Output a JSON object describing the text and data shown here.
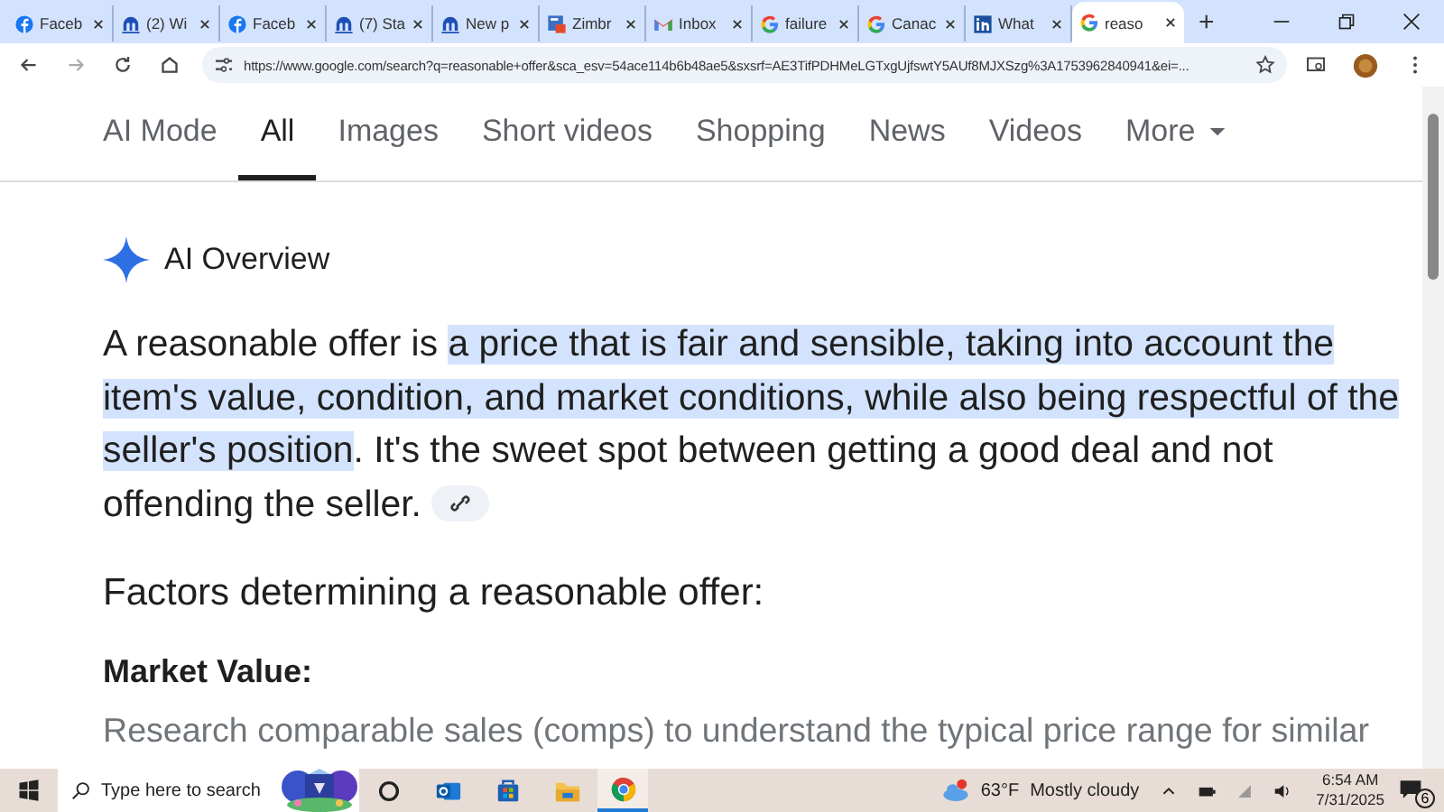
{
  "browser": {
    "tabs": [
      {
        "title": "Faceb",
        "kind": "facebook",
        "selected": false
      },
      {
        "title": "(2) Wi",
        "kind": "m",
        "selected": false
      },
      {
        "title": "Faceb",
        "kind": "facebook",
        "selected": false
      },
      {
        "title": "(7) Sta",
        "kind": "m",
        "selected": false
      },
      {
        "title": "New p",
        "kind": "m",
        "selected": false
      },
      {
        "title": "Zimbr",
        "kind": "zimbra",
        "selected": false
      },
      {
        "title": "Inbox",
        "kind": "gmail",
        "selected": false
      },
      {
        "title": "failure",
        "kind": "google",
        "selected": false
      },
      {
        "title": "Canac",
        "kind": "google",
        "selected": false
      },
      {
        "title": "What",
        "kind": "linkedin",
        "selected": false
      },
      {
        "title": "reaso",
        "kind": "google",
        "selected": true
      }
    ],
    "new_tab": "+",
    "url": "https://www.google.com/search?q=reasonable+offer&sca_esv=54ace114b6b48ae5&sxsrf=AE3TifPDHMeLGTxgUjfswtY5AUf8MJXSzg%3A1753962840941&ei=..."
  },
  "search_tabs": [
    {
      "label": "AI Mode",
      "selected": false
    },
    {
      "label": "All",
      "selected": true
    },
    {
      "label": "Images",
      "selected": false
    },
    {
      "label": "Short videos",
      "selected": false
    },
    {
      "label": "Shopping",
      "selected": false
    },
    {
      "label": "News",
      "selected": false
    },
    {
      "label": "Videos",
      "selected": false
    },
    {
      "label": "More",
      "selected": false,
      "kind": "menu"
    }
  ],
  "ai_overview": {
    "title": "AI Overview",
    "summary": [
      {
        "text": "A reasonable offer is ",
        "highlighted": false
      },
      {
        "text": "a price that is fair and sensible, taking into account the item's value, condition, and market conditions, while also being respectful of the seller's position",
        "highlighted": true
      },
      {
        "text": ". It's the sweet spot between getting a good deal and not offending the seller.",
        "highlighted": false
      }
    ],
    "heading": "Factors determining a reasonable offer:",
    "subheading": "Market Value:",
    "body": "Research comparable sales (comps) to understand the typical price range for similar"
  },
  "taskbar": {
    "search_placeholder": "Type here to search",
    "temperature": "63°F",
    "weather": "Mostly cloudy",
    "time": "6:54 AM",
    "date": "7/31/2025",
    "notifications": "6"
  }
}
